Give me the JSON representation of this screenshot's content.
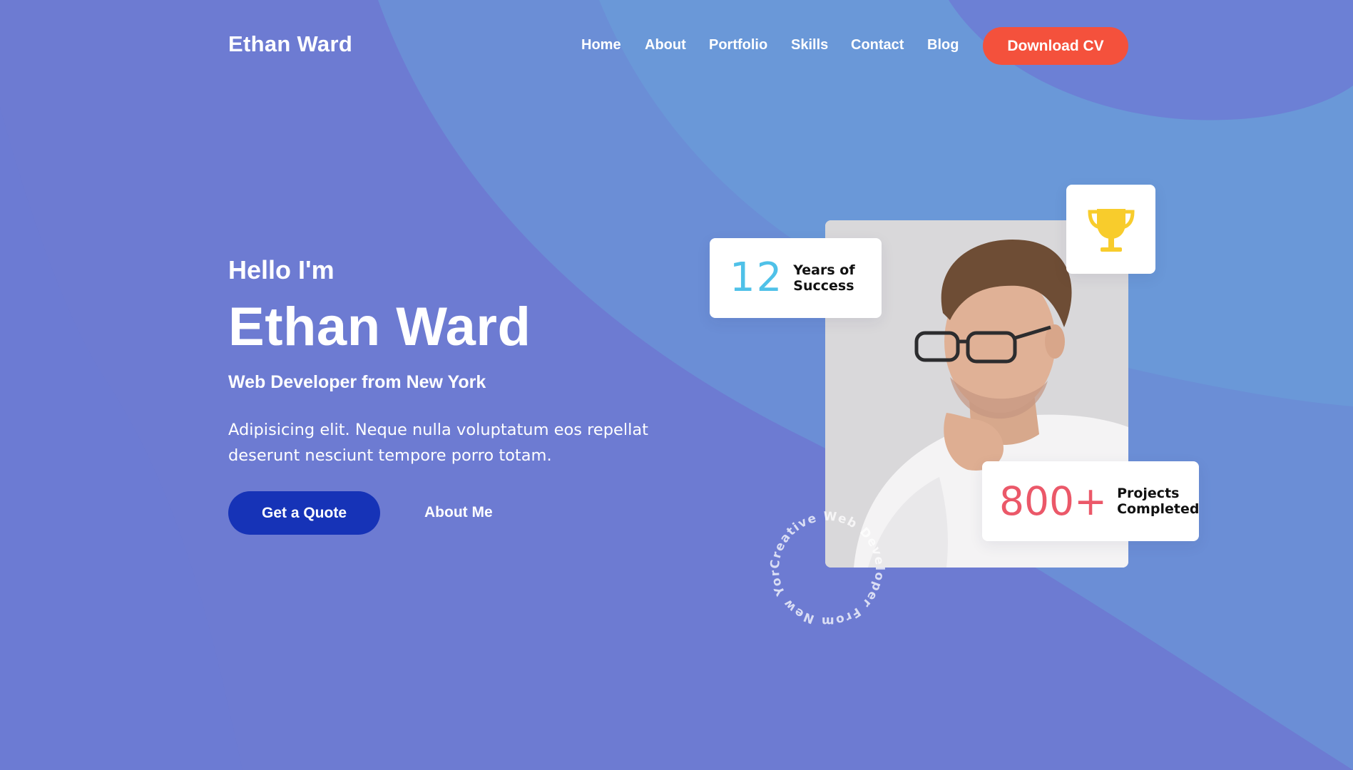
{
  "header": {
    "brand": "Ethan Ward",
    "nav": [
      "Home",
      "About",
      "Portfolio",
      "Skills",
      "Contact",
      "Blog"
    ],
    "cta_label": "Download CV"
  },
  "hero": {
    "greeting": "Hello I'm",
    "name": "Ethan Ward",
    "tagline": "Web Developer from New York",
    "description": "Adipisicing elit. Neque nulla voluptatum eos repellat deserunt nesciunt tempore porro totam.",
    "primary_button": "Get a Quote",
    "secondary_link": "About Me"
  },
  "stats": {
    "years_value": "12",
    "years_label_line1": "Years of",
    "years_label_line2": "Success",
    "projects_value": "800+",
    "projects_label_line1": "Projects",
    "projects_label_line2": "Completed"
  },
  "badge": {
    "circular_text": "Creative Web Developer From New York"
  },
  "icons": {
    "trophy": "trophy-icon"
  },
  "colors": {
    "background": "#6d7bd2",
    "accent_orange": "#f4513c",
    "button_blue": "#1633b7",
    "years_blue": "#4fc1e8",
    "projects_red": "#eb5869",
    "trophy_yellow": "#f8cc2c"
  }
}
